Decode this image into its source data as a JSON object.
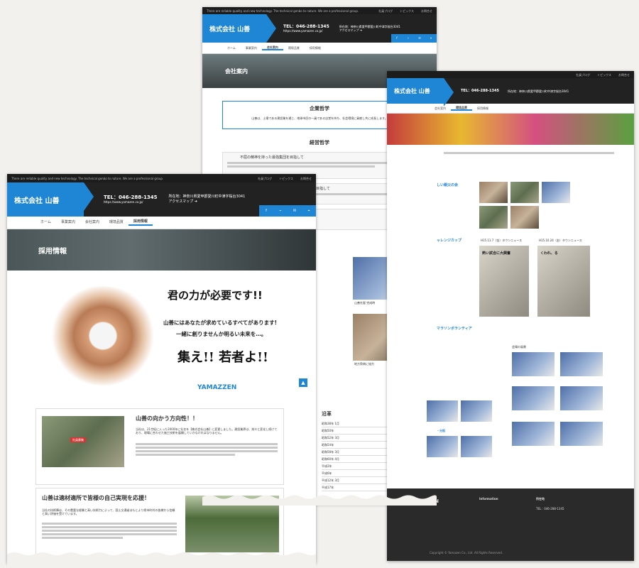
{
  "site": {
    "tagline": "There are reliable quality and new technology. The technical genbo to nature. We are a professional group.",
    "top_links": [
      "社員ブログ",
      "トピックス",
      "お問合せ"
    ],
    "company_name": "株式会社 山善",
    "phone": "TEL：046-288-1345",
    "url": "https://www.yamazen.co.jp/",
    "address": "所在地：神奈川県愛甲郡愛川町中津字桜台3041",
    "access": "アクセスマップ ➜",
    "nav": [
      "ホーム",
      "事業案内",
      "会社案内",
      "環境品質",
      "採用情報"
    ],
    "social_icons": [
      "facebook-icon",
      "rss-icon",
      "mail-icon",
      "map-pin-icon"
    ],
    "accent": "#1f86d6"
  },
  "recruit": {
    "page_title": "採用情報",
    "hero_headline": "君の力が必要です!!",
    "hero_line1": "山善にはあなたが求めているすべてがあります!",
    "hero_line2": "一緒に創りませんか明るい未来を…。",
    "hero_slogan": "集え!! 若者よ!!",
    "hero_logo": "YAMAZZEN",
    "sec1_title": "山善の向かう方向性！！",
    "sec1_sign": "社員募集",
    "sec1_body": "当社は、21世紀に入った2000年に社名を【株式会社山善】に変更しました。建設業界は、刻々と変化し続けており、現場に合わせた施工技術を展開していかなければなりません。",
    "sec2_title": "山善は適材適所で皆様の自己実現を応援！",
    "sec2_body": "当社の技術陣は、その豊富な経験と高い技術力によって、国土交通省はもとより県市町村の皆様から信頼と高い評価を受けています。"
  },
  "company": {
    "page_title": "会社案内",
    "philosophy_title": "企業哲学",
    "philosophy_body": "山善は、土壌である建設業を通じ、地球市民の一員である自覚を持ち、社会環境に貢献し共に成長します。",
    "policy_title": "経営哲学",
    "policy_item": "不屈の精神を持った最強集団を目指して",
    "policy_item2": "を目指して",
    "history_title": "沿革",
    "history_rows": [
      "昭和38年 1月",
      "昭和50年",
      "昭和52年 3月",
      "昭和54年",
      "昭和58年 3月",
      "昭和60年 4月",
      "平成2年",
      "平成6年",
      "平成12年 3月",
      "平成17年"
    ],
    "photo_cap1": "山善社屋 完成時",
    "photo_cap2": "地方祭典に協力"
  },
  "env": {
    "sec_title": "しい親父の会",
    "cup_title": "ャレンジカップ",
    "news1": "H15.11.7（金）タウンニュース",
    "news2": "H15.10.24（金）タウンニュース",
    "news_head1": "熱い試合に大興奮",
    "news_head2": "くわれ、る",
    "marathon_title": "マラソンボランティア",
    "scene_label": "会場の風景",
    "section_division": "・分担"
  },
  "footer": {
    "logo": "YAMAZZEN",
    "info_title": "Information",
    "address_title": "所在地",
    "tel": "TEL：046-288-1345",
    "copyright": "Copyright © Yamazen Co., Ltd. All Rights Reserved."
  }
}
